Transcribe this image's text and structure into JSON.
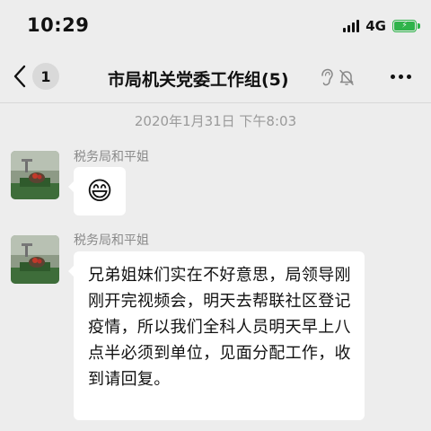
{
  "status_bar": {
    "time": "10:29",
    "network": "4G",
    "battery_color": "#2fb34a"
  },
  "nav": {
    "unread_count": "1",
    "title": "市局机关党委工作组(5)",
    "icons": [
      "back-chevron-icon",
      "ear-icon",
      "mute-bell-icon",
      "more-icon"
    ]
  },
  "timestamp": "2020年1月31日 下午8:03",
  "messages": [
    {
      "sender": "税务局和平姐",
      "content": "😄",
      "type": "emoji"
    },
    {
      "sender": "税务局和平姐",
      "content": "兄弟姐妹们实在不好意思，局领导刚刚开完视频会，明天去帮联社区登记疫情，所以我们全科人员明天早上八点半必须到单位，见面分配工作，收到请回复。",
      "type": "text"
    }
  ],
  "colors": {
    "background": "#ededed",
    "bubble": "#ffffff",
    "timestamp_text": "#9a9a9a",
    "sender_text": "#8a8a8a"
  }
}
